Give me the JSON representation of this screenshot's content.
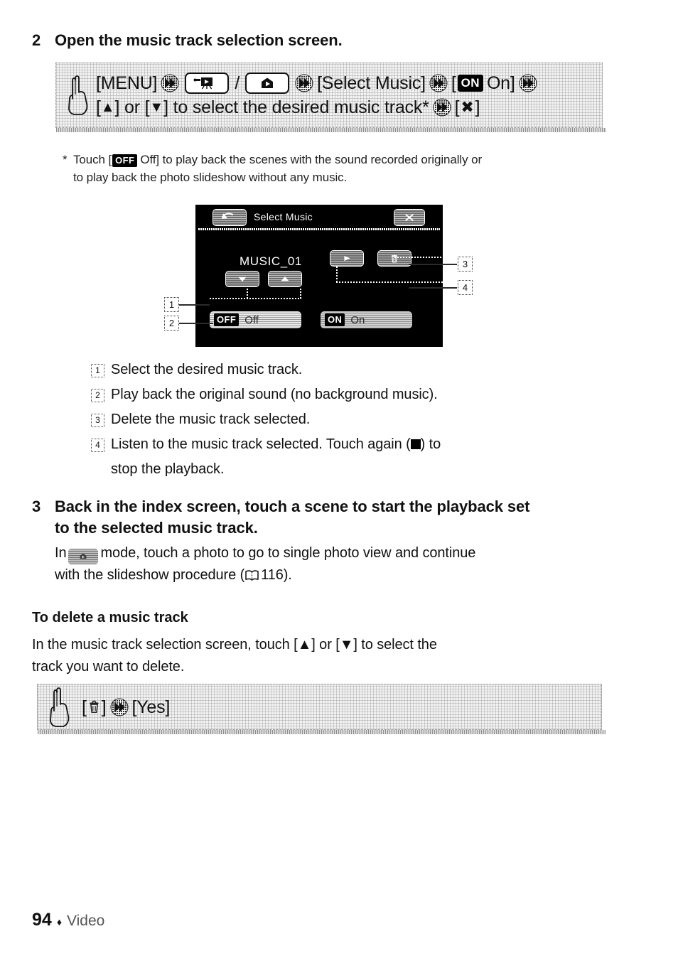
{
  "page": {
    "number": "94",
    "separator": "♦",
    "section": "Video"
  },
  "step2": {
    "number": "2",
    "title": "Open the music track selection screen.",
    "callout": {
      "hand_icon": "pointing-hand-icon",
      "line1": {
        "menu": "[MENU]",
        "chev1": "chevron-double-right-icon",
        "mode_video_icon": "video-playback-mode-icon",
        "slash": "/",
        "mode_photo_icon": "photo-playback-mode-icon",
        "chev2": "chevron-double-right-icon",
        "select_music": "[Select Music]",
        "chev3": "chevron-double-right-icon",
        "on_open": "[",
        "on_badge": "ON",
        "on_label": "On]",
        "chev4": "chevron-double-right-icon"
      },
      "line2": {
        "text_a": "[",
        "up": "▲",
        "text_b": "] or [",
        "down": "▼",
        "text_c": "] to select the desired music track*",
        "chev5": "chevron-double-right-icon",
        "close_open": "[",
        "close_glyph": "✖",
        "close_end": "]"
      }
    },
    "footnote": {
      "marker": "*",
      "pre": "Touch [",
      "badge": "OFF",
      "mid": "Off] to play back the scenes with the sound recorded originally or",
      "line2": "to play back the photo slideshow without any music."
    }
  },
  "screen": {
    "back_icon": "back-arrow-icon",
    "title": "Select Music",
    "close_icon": "close-x-icon",
    "track_name": "MUSIC_01",
    "down_icon": "arrow-down-icon",
    "up_icon": "arrow-up-icon",
    "play_icon": "play-icon",
    "delete_icon": "trash-icon",
    "off_badge": "OFF",
    "off_label": "Off",
    "on_badge": "ON",
    "on_label": "On",
    "callouts": [
      "1",
      "2",
      "3",
      "4"
    ]
  },
  "legend": [
    {
      "num": "1",
      "text": "Select the desired music track."
    },
    {
      "num": "2",
      "text": "Play back the original sound (no background music)."
    },
    {
      "num": "3",
      "text": "Delete the music track selected."
    },
    {
      "num": "4",
      "text_a": "Listen to the music track selected. Touch again (",
      "stop_icon": "stop-square-icon",
      "text_b": ") to",
      "text_c": "stop the playback."
    }
  ],
  "step3": {
    "number": "3",
    "title_line1": "Back in the index screen, touch a scene to start the playback set",
    "title_line2": "to the selected music track.",
    "body_pre": "In",
    "mode_icon": "photo-playback-mode-icon",
    "body_mid": "mode, touch a photo to go to single photo view and continue",
    "body_line2_pre": "with the slideshow procedure (",
    "book_icon": "book-reference-icon",
    "page_ref": "116",
    "body_line2_post": ")."
  },
  "delete_section": {
    "heading": "To delete a music track",
    "line1_a": "In the music track selection screen, touch [",
    "up": "▲",
    "line1_b": "] or [",
    "down": "▼",
    "line1_c": "] to select the",
    "line2": "track you want to delete.",
    "callout": {
      "hand_icon": "pointing-hand-icon",
      "open": "[",
      "trash_icon": "trash-icon",
      "close": "]",
      "chev": "chevron-double-right-icon",
      "yes": "[Yes]"
    }
  }
}
